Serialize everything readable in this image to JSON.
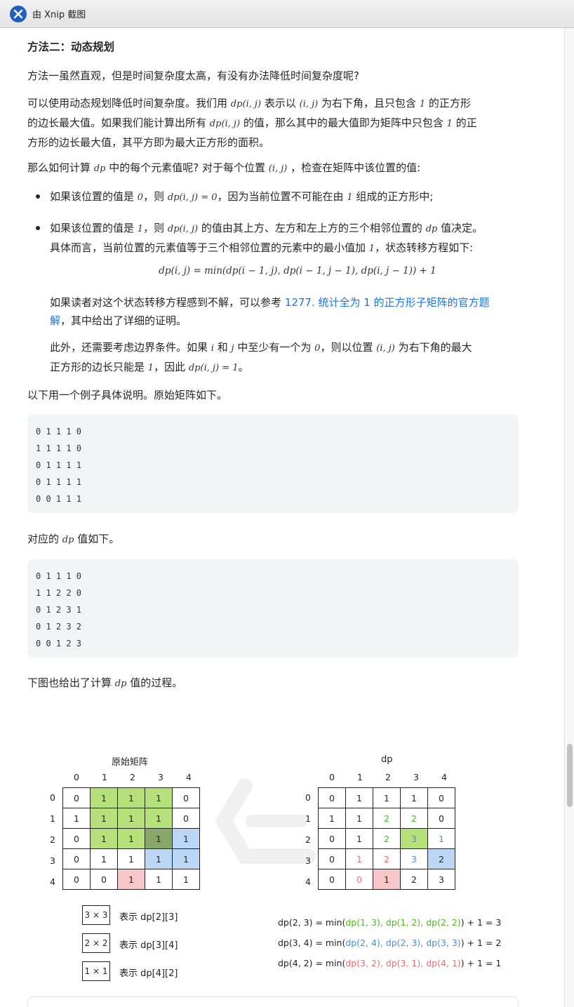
{
  "window": {
    "title": "由 Xnip 截图"
  },
  "section": {
    "heading": "方法二：动态规划"
  },
  "paragraphs": {
    "p1": "方法一虽然直观，但是时间复杂度太高，有没有办法降低时间复杂度呢?",
    "p2_a": "可以使用动态规划降低时间复杂度。我们用",
    "p2_b": "表示以",
    "p2_c": "为右下角，且只包含",
    "p2_d": "的正方形",
    "p2_e": "的边长最大值。如果我们能计算出所有",
    "p2_f": "的值，那么其中的最大值即为矩阵中只包含",
    "p2_g": "的正",
    "p2_h": "方形的边长最大值，其平方即为最大正方形的面积。",
    "p3_a": "那么如何计算",
    "p3_b": "中的每个元素值呢? 对于每个位置",
    "p3_c": "，检查在矩阵中该位置的值:",
    "b1_a": "如果该位置的值是",
    "b1_b": "，则",
    "b1_c": "，因为当前位置不可能在由",
    "b1_d": "组成的正方形中;",
    "b2_a": "如果该位置的值是",
    "b2_b": "，则",
    "b2_c": "的值由其上方、左方和左上方的三个相邻位置的",
    "b2_d": "值决定。",
    "b2_e": "具体而言，当前位置的元素值等于三个相邻位置的元素中的最小值加",
    "b2_f": "，状态转移方程如下:",
    "ref_a": "如果读者对这个状态转移方程感到不解，可以参考",
    "ref_link_1": "1277. 统计全为 1 的正方形子矩阵的官方题",
    "ref_link_2": "解",
    "ref_b": "，其中给出了详细的证明。",
    "bd_a": "此外，还需要考虑边界条件。如果",
    "bd_b": "和",
    "bd_c": "中至少有一个为",
    "bd_d": "，则以位置",
    "bd_e": "为右下角的最大",
    "bd_f": "正方形的边长只能是",
    "bd_g": "，因此",
    "bd_h": "。",
    "ex_intro": "以下用一个例子具体说明。原始矩阵如下。",
    "dp_intro_a": "对应的",
    "dp_intro_b": "值如下。",
    "fig_intro_a": "下图也给出了计算",
    "fig_intro_b": "值的过程。"
  },
  "math": {
    "dp_ij": "dp(i, j)",
    "ij": "(i, j)",
    "one": "1",
    "zero": "0",
    "dp": "dp",
    "i": "i",
    "j": "j",
    "dp_ij_eq0": "dp(i, j) = 0",
    "dp_ij_eq1": "dp(i, j) = 1",
    "transition": "dp(i, j) = min(dp(i − 1, j), dp(i − 1, j − 1), dp(i, j − 1)) + 1"
  },
  "code": {
    "original": [
      "0 1 1 1 0",
      "1 1 1 1 0",
      "0 1 1 1 1",
      "0 1 1 1 1",
      "0 0 1 1 1"
    ],
    "dp": [
      "0 1 1 1 0",
      "1 1 2 2 0",
      "0 1 2 3 1",
      "0 1 2 3 2",
      "0 0 1 2 3"
    ]
  },
  "figure": {
    "left_title": "原始矩阵",
    "right_title": "dp",
    "col_labels": [
      "0",
      "1",
      "2",
      "3",
      "4"
    ],
    "row_labels": [
      "0",
      "1",
      "2",
      "3",
      "4"
    ],
    "original": [
      [
        0,
        1,
        1,
        1,
        0
      ],
      [
        1,
        1,
        1,
        1,
        0
      ],
      [
        0,
        1,
        1,
        1,
        1
      ],
      [
        0,
        1,
        1,
        1,
        1
      ],
      [
        0,
        0,
        1,
        1,
        1
      ]
    ],
    "dp": [
      [
        0,
        1,
        1,
        1,
        0
      ],
      [
        1,
        1,
        2,
        2,
        0
      ],
      [
        0,
        1,
        2,
        3,
        1
      ],
      [
        0,
        1,
        2,
        3,
        2
      ],
      [
        0,
        0,
        1,
        2,
        3
      ]
    ],
    "colors": {
      "green": "#b5e07a",
      "dark": "#8aa76a",
      "blue": "#bcd7f5",
      "red": "#f6c6c9",
      "green_text": "#4db81f",
      "blue_text": "#3f8ee8",
      "red_text": "#f06c6c"
    },
    "legend": [
      {
        "box": "3 × 3",
        "text": "表示 dp[2][3]",
        "color": "#b5e07a"
      },
      {
        "box": "2 × 2",
        "text": "表示 dp[3][4]",
        "color": "#bcd7f5"
      },
      {
        "box": "1 × 1",
        "text": "表示 dp[4][2]",
        "color": "#f6c6c9"
      }
    ],
    "equations": [
      {
        "lhs": "dp(2, 3) = min(",
        "args": "dp(1, 3), dp(1, 2), dp(2, 2)",
        "rhs": ") + 1 = 3",
        "color": "#4db81f"
      },
      {
        "lhs": "dp(3, 4) = min(",
        "args": "dp(2, 4), dp(2, 3), dp(3, 3)",
        "rhs": ") + 1 = 2",
        "color": "#3f8ee8"
      },
      {
        "lhs": "dp(4, 2) = min(",
        "args": "dp(3, 2), dp(3, 1), dp(4, 1)",
        "rhs": ") + 1 = 1",
        "color": "#f06c6c"
      }
    ]
  }
}
